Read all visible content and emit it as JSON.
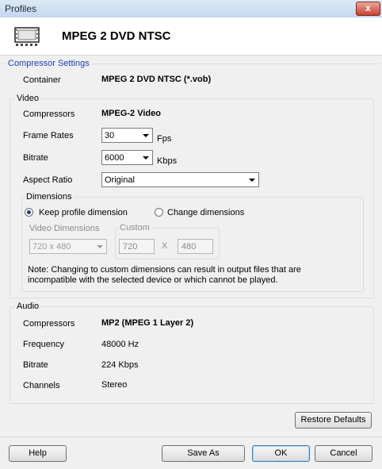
{
  "window": {
    "title": "Profiles",
    "close_glyph": "x"
  },
  "header": {
    "title": "MPEG 2 DVD NTSC",
    "icon": "film-icon"
  },
  "compressor_settings": {
    "group_label": "Compressor Settings",
    "container_label": "Container",
    "container_value": "MPEG 2 DVD NTSC (*.vob)"
  },
  "video": {
    "group_label": "Video",
    "compressors_label": "Compressors",
    "compressors_value": "MPEG-2 Video",
    "frame_rates_label": "Frame Rates",
    "frame_rates_value": "30",
    "frame_rates_unit": "Fps",
    "bitrate_label": "Bitrate",
    "bitrate_value": "6000",
    "bitrate_unit": "Kbps",
    "aspect_ratio_label": "Aspect Ratio",
    "aspect_ratio_value": "Original",
    "dimensions": {
      "group_label": "Dimensions",
      "keep_label": "Keep profile dimension",
      "change_label": "Change dimensions",
      "video_dimensions_label": "Video Dimensions",
      "video_dimensions_value": "720 x 480",
      "custom_label": "Custom",
      "custom_width": "720",
      "custom_x": "X",
      "custom_height": "480",
      "note_line1": "Note: Changing to custom dimensions can result in output files that are",
      "note_line2": "incompatible with the selected device or which cannot be played."
    }
  },
  "audio": {
    "group_label": "Audio",
    "compressors_label": "Compressors",
    "compressors_value": "MP2 (MPEG 1 Layer 2)",
    "frequency_label": "Frequency",
    "frequency_value": "48000  Hz",
    "bitrate_label": "Bitrate",
    "bitrate_value": "224  Kbps",
    "channels_label": "Channels",
    "channels_value": "Stereo"
  },
  "buttons": {
    "restore_defaults": "Restore Defaults",
    "help": "Help",
    "save_as": "Save As",
    "ok": "OK",
    "cancel": "Cancel"
  }
}
